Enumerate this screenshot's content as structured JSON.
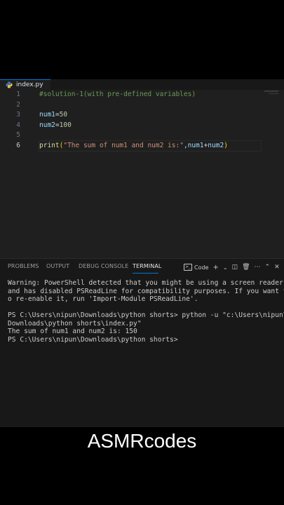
{
  "editor": {
    "tab_label": "index.py",
    "lines": [
      {
        "num": "1",
        "tokens": [
          {
            "t": "#solution-1(with pre-defined variables)",
            "c": "c-comment"
          }
        ]
      },
      {
        "num": "2",
        "tokens": []
      },
      {
        "num": "3",
        "tokens": [
          {
            "t": "num1",
            "c": "c-var"
          },
          {
            "t": "=",
            "c": "c-op"
          },
          {
            "t": "50",
            "c": "c-num"
          }
        ]
      },
      {
        "num": "4",
        "tokens": [
          {
            "t": "num2",
            "c": "c-var"
          },
          {
            "t": "=",
            "c": "c-op"
          },
          {
            "t": "100",
            "c": "c-num"
          }
        ]
      },
      {
        "num": "5",
        "tokens": []
      },
      {
        "num": "6",
        "active": true,
        "tokens": [
          {
            "t": "print",
            "c": "c-fn"
          },
          {
            "t": "(",
            "c": "c-br"
          },
          {
            "t": "\"The sum of num1 and num2 is:\"",
            "c": "c-str"
          },
          {
            "t": ",",
            "c": "c-op"
          },
          {
            "t": "num1",
            "c": "c-var"
          },
          {
            "t": "+",
            "c": "c-op"
          },
          {
            "t": "num2",
            "c": "c-var"
          },
          {
            "t": ")",
            "c": "c-br"
          }
        ]
      }
    ]
  },
  "panel": {
    "tabs": [
      "PROBLEMS",
      "OUTPUT",
      "DEBUG CONSOLE",
      "TERMINAL"
    ],
    "active_tab": "TERMINAL",
    "tools_label": "Code",
    "terminal_lines": [
      "Warning: PowerShell detected that you might be using a screen reader",
      "and has disabled PSReadLine for compatibility purposes. If you want t",
      "o re-enable it, run 'Import-Module PSReadLine'.",
      "",
      "PS C:\\Users\\nipun\\Downloads\\python shorts> python -u \"c:\\Users\\nipun\\",
      "Downloads\\python shorts\\index.py\"",
      "The sum of num1 and num2 is: 150",
      "PS C:\\Users\\nipun\\Downloads\\python shorts> "
    ]
  },
  "brand": "ASMRcodes"
}
